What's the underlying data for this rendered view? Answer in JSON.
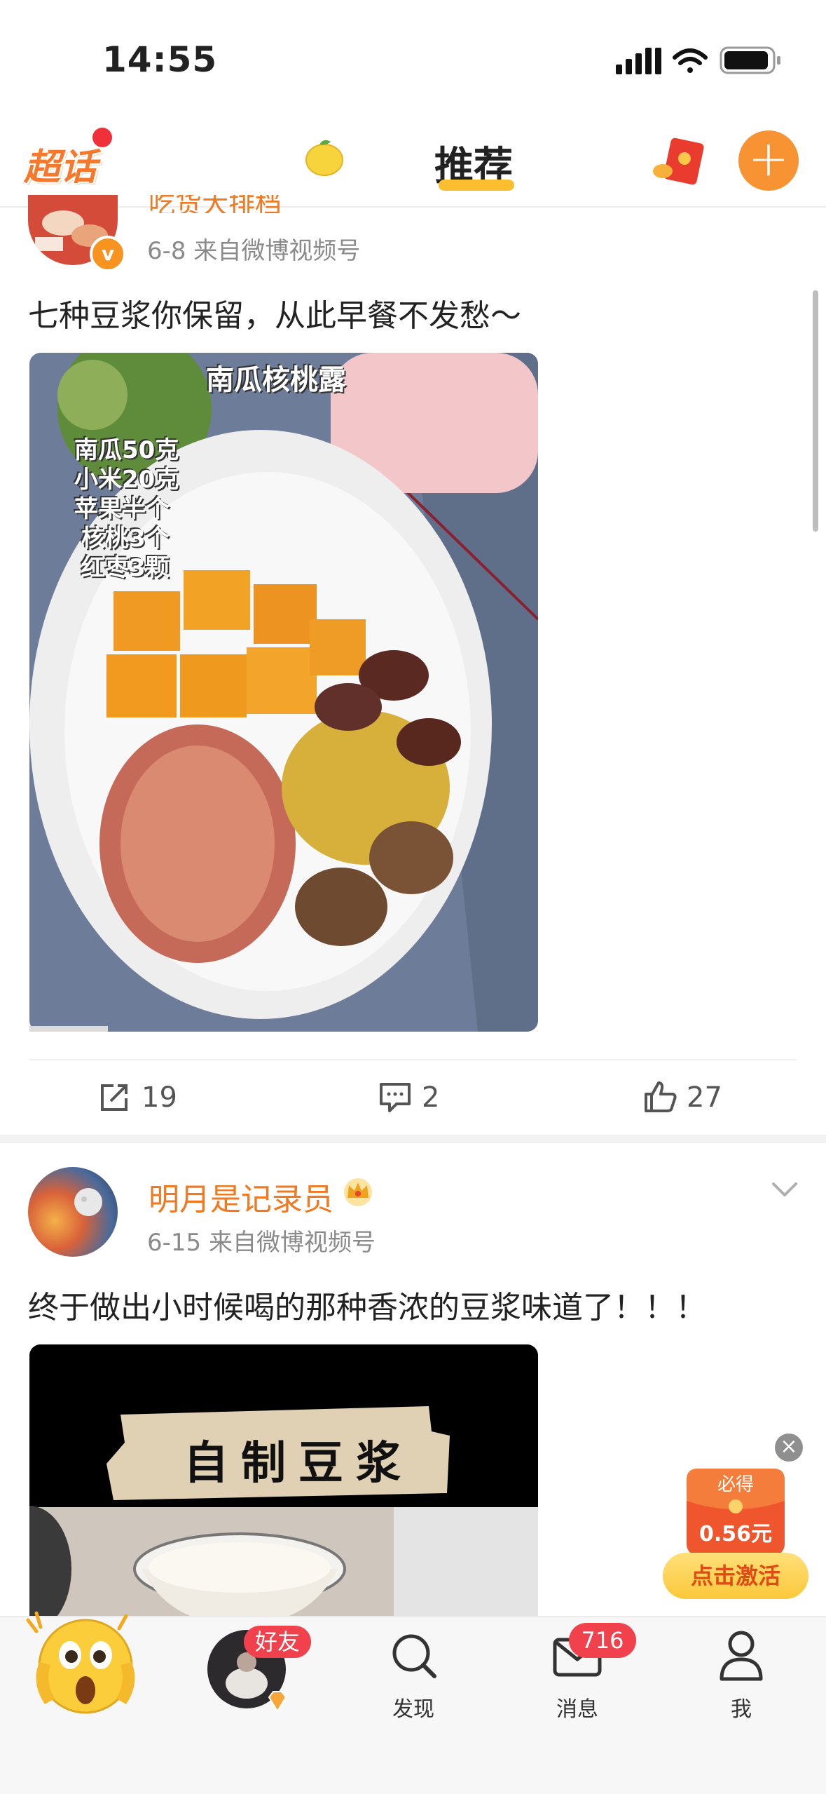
{
  "status_bar": {
    "time": "14:55"
  },
  "header": {
    "logo_text": "超话",
    "active_tab": "推荐",
    "add_symbol": "+"
  },
  "post1": {
    "author": "吃货大排档",
    "meta": "6-8  来自微博视频号",
    "text": "七种豆浆你保留，从此早餐不发愁～",
    "media": {
      "title": "南瓜核桃露",
      "ingredients": [
        "南瓜50克",
        "小米20克",
        "苹果半个",
        "核桃3个",
        "红枣3颗"
      ]
    },
    "actions": {
      "repost": "19",
      "comment": "2",
      "like": "27"
    }
  },
  "post2": {
    "author": "明月是记录员",
    "meta": "6-15  来自微博视频号",
    "text": "终于做出小时候喝的那种香浓的豆浆味道了！！！",
    "media": {
      "title": "自制豆浆"
    }
  },
  "reward": {
    "close": "×",
    "must_get": "必得",
    "amount": "0.56元",
    "activate": "点击激活"
  },
  "tabbar": {
    "friends_badge": "好友",
    "discover": "发现",
    "messages": "消息",
    "messages_badge": "716",
    "me": "我"
  },
  "colors": {
    "accent": "#f07a24",
    "badge_red": "#f0414c",
    "tab_underline": "#fbbe2f"
  }
}
